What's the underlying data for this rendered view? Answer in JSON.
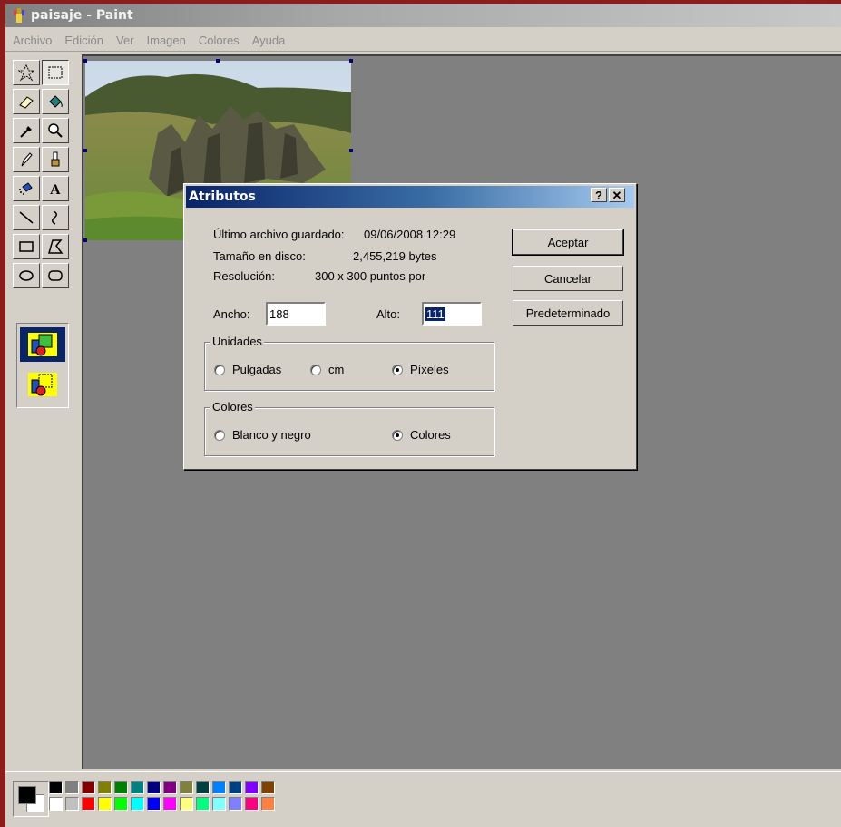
{
  "window": {
    "title": "paisaje - Paint",
    "icon": "paint-app-icon"
  },
  "menubar": {
    "items": [
      "Archivo",
      "Edición",
      "Ver",
      "Imagen",
      "Colores",
      "Ayuda"
    ]
  },
  "toolbox": {
    "tools": [
      "free-select",
      "rect-select",
      "eraser",
      "fill-bucket",
      "color-picker",
      "magnifier",
      "pencil",
      "brush",
      "airbrush",
      "text",
      "line",
      "curve",
      "rectangle",
      "polygon",
      "ellipse",
      "rounded-rectangle"
    ],
    "selected_tool": "rect-select"
  },
  "dialog": {
    "title": "Atributos",
    "help_label": "?",
    "close_label": "✕",
    "last_saved_label": "Último archivo guardado:",
    "last_saved_value": "09/06/2008 12:29",
    "size_label": "Tamaño en disco:",
    "size_value": "2,455,219 bytes",
    "resolution_label": "Resolución:",
    "resolution_value": "300 x 300 puntos por",
    "width_label": "Ancho:",
    "width_value": "188",
    "height_label": "Alto:",
    "height_value": "111",
    "units_group": "Unidades",
    "units_options": [
      "Pulgadas",
      "cm",
      "Píxeles"
    ],
    "units_selected": "Píxeles",
    "colors_group": "Colores",
    "colors_options": [
      "Blanco y negro",
      "Colores"
    ],
    "colors_selected": "Colores",
    "buttons": {
      "ok": "Aceptar",
      "cancel": "Cancelar",
      "default": "Predeterminado"
    }
  },
  "palette": {
    "foreground": "#000000",
    "background": "#ffffff",
    "top_row": [
      "#000000",
      "#808080",
      "#800000",
      "#808000",
      "#008000",
      "#008080",
      "#000080",
      "#800080",
      "#808040",
      "#004040",
      "#0080ff",
      "#004080",
      "#8000ff",
      "#804000"
    ],
    "bottom_row": [
      "#ffffff",
      "#c0c0c0",
      "#ff0000",
      "#ffff00",
      "#00ff00",
      "#00ffff",
      "#0000ff",
      "#ff00ff",
      "#ffff80",
      "#00ff80",
      "#80ffff",
      "#8080ff",
      "#ff0080",
      "#ff8040"
    ]
  }
}
